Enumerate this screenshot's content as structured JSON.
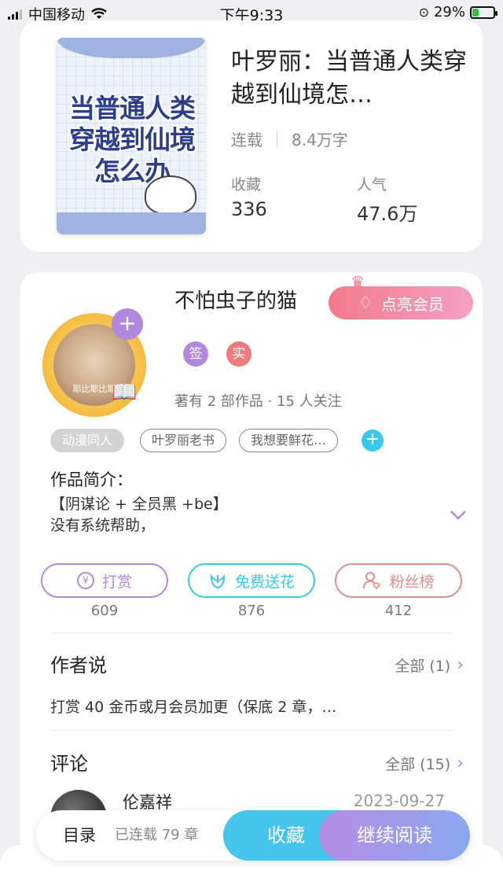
{
  "status_bar": {
    "carrier": "中国移动",
    "time": "下午9:33",
    "battery_percent": "29%",
    "battery_level": 0.29
  },
  "book": {
    "cover_title": "当普通人类穿越到仙境怎么办",
    "title": "叶罗丽：当普通人类穿越到仙境怎…",
    "status": "连载",
    "word_count": "8.4万字",
    "favorites_label": "收藏",
    "favorites_value": "336",
    "popularity_label": "人气",
    "popularity_value": "47.6万"
  },
  "author": {
    "name": "不怕虫子的猫",
    "avatar_caption": "耶比耶比耶",
    "vip_button": "点亮会员",
    "badge_sign": "签",
    "badge_real": "实",
    "stats": "著有 2 部作品 · 15 人关注",
    "tags": [
      "动漫同人",
      "叶罗丽老书",
      "我想要鲜花…"
    ],
    "tag_add": "+"
  },
  "intro": {
    "label": "作品简介：",
    "line1": "【阴谋论 + 全员黑 +be】",
    "line2": "没有系统帮助，"
  },
  "actions": {
    "tip_label": "打赏",
    "tip_count": "609",
    "flower_label": "免费送花",
    "flower_count": "876",
    "fans_label": "粉丝榜",
    "fans_count": "412"
  },
  "author_says": {
    "heading": "作者说",
    "more": "全部 (1)",
    "text": "打赏 40 金币或月会员加更（保底 2 章，…"
  },
  "comments": {
    "heading": "评论",
    "more": "全部 (15)",
    "first_user": "伦嘉祥",
    "first_date": "2023-09-27"
  },
  "bottom_bar": {
    "toc_label": "目录",
    "chapters": "已连载 79 章",
    "favorite_button": "收藏",
    "read_button": "继续阅读"
  },
  "colors": {
    "accent_purple": "#b088e0",
    "accent_blue": "#44c5ee",
    "accent_pink": "#f37a8a",
    "tip_color": "#b088e0",
    "flower_color": "#39c8ea",
    "fans_color": "#e98a8a"
  }
}
